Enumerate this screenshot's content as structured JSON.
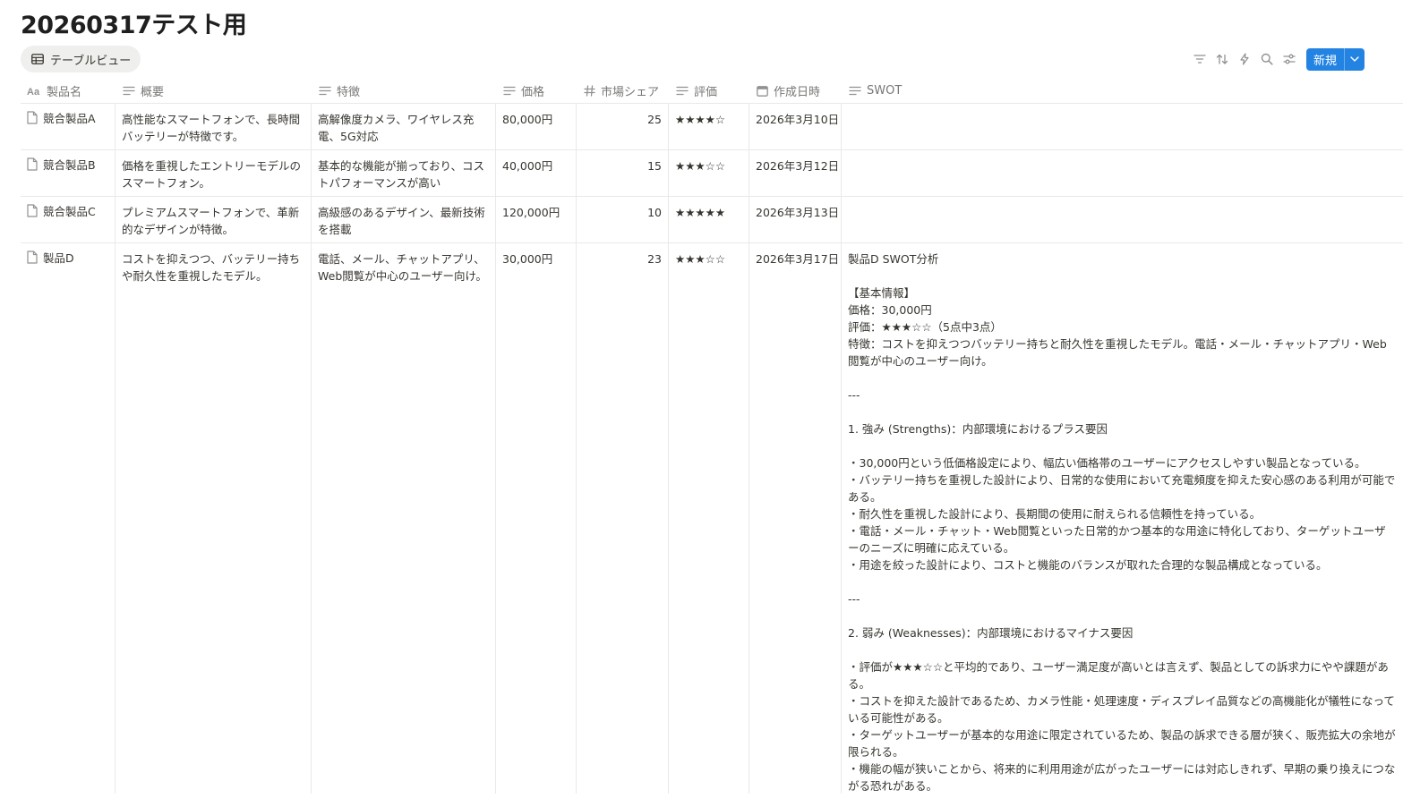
{
  "page": {
    "title": "20260317テスト用"
  },
  "view": {
    "tab_label": "テーブルビュー"
  },
  "toolbar": {
    "icons": [
      "filter-icon",
      "sort-icon",
      "automation-icon",
      "search-icon",
      "settings-icon"
    ],
    "new_label": "新規",
    "accent": "#2383e2"
  },
  "columns": [
    {
      "label": "製品名",
      "icon": "title-icon"
    },
    {
      "label": "概要",
      "icon": "text-icon"
    },
    {
      "label": "特徴",
      "icon": "text-icon"
    },
    {
      "label": "価格",
      "icon": "text-icon"
    },
    {
      "label": "市場シェア",
      "icon": "number-icon"
    },
    {
      "label": "評価",
      "icon": "text-icon"
    },
    {
      "label": "作成日時",
      "icon": "calendar-icon"
    },
    {
      "label": "SWOT",
      "icon": "text-icon"
    }
  ],
  "rows": [
    {
      "name": "競合製品A",
      "summary": "高性能なスマートフォンで、長時間バッテリーが特徴です。",
      "feature": "高解像度カメラ、ワイヤレス充電、5G対応",
      "price": "80,000円",
      "share": "25",
      "rating": "★★★★☆",
      "created": "2026年3月10日",
      "swot": ""
    },
    {
      "name": "競合製品B",
      "summary": "価格を重視したエントリーモデルのスマートフォン。",
      "feature": "基本的な機能が揃っており、コストパフォーマンスが高い",
      "price": "40,000円",
      "share": "15",
      "rating": "★★★☆☆",
      "created": "2026年3月12日",
      "swot": ""
    },
    {
      "name": "競合製品C",
      "summary": "プレミアムスマートフォンで、革新的なデザインが特徴。",
      "feature": "高級感のあるデザイン、最新技術を搭載",
      "price": "120,000円",
      "share": "10",
      "rating": "★★★★★",
      "created": "2026年3月13日",
      "swot": ""
    },
    {
      "name": "製品D",
      "summary": "コストを抑えつつ、バッテリー持ちや耐久性を重視したモデル。",
      "feature": "電話、メール、チャットアプリ、Web閲覧が中心のユーザー向け。",
      "price": "30,000円",
      "share": "23",
      "rating": "★★★☆☆",
      "created": "2026年3月17日",
      "swot": "製品D SWOT分析\n\n【基本情報】\n価格：30,000円\n評価：★★★☆☆（5点中3点）\n特徴：コストを抑えつつバッテリー持ちと耐久性を重視したモデル。電話・メール・チャットアプリ・Web閲覧が中心のユーザー向け。\n\n---\n\n1. 強み (Strengths)：内部環境におけるプラス要因\n\n・30,000円という低価格設定により、幅広い価格帯のユーザーにアクセスしやすい製品となっている。\n・バッテリー持ちを重視した設計により、日常的な使用において充電頻度を抑えた安心感のある利用が可能である。\n・耐久性を重視した設計により、長期間の使用に耐えられる信頼性を持っている。\n・電話・メール・チャット・Web閲覧といった日常的かつ基本的な用途に特化しており、ターゲットユーザーのニーズに明確に応えている。\n・用途を絞った設計により、コストと機能のバランスが取れた合理的な製品構成となっている。\n\n---\n\n2. 弱み (Weaknesses)：内部環境におけるマイナス要因\n\n・評価が★★★☆☆と平均的であり、ユーザー満足度が高いとは言えず、製品としての訴求力にやや課題がある。\n・コストを抑えた設計であるため、カメラ性能・処理速度・ディスプレイ品質などの高機能化が犠牲になっている可能性がある。\n・ターゲットユーザーが基本的な用途に限定されているため、製品の訴求できる層が狭く、販売拡大の余地が限られる。\n・機能の幅が狭いことから、将来的に利用用途が広がったユーザーには対応しきれず、早期の乗り換えにつながる恐れがある。"
    }
  ]
}
